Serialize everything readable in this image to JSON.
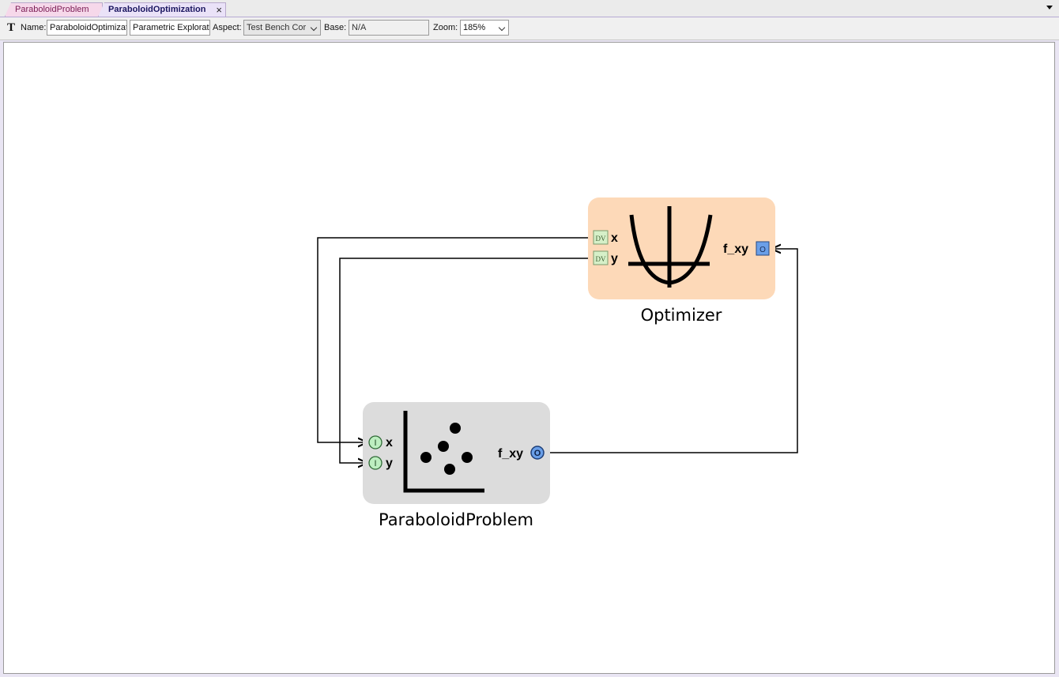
{
  "tabs": [
    {
      "label": "ParaboloidProblem"
    },
    {
      "label": "ParaboloidOptimization",
      "close": "×"
    }
  ],
  "toolbar": {
    "name_label": "Name:",
    "name_value": "ParaboloidOptimizati",
    "kind_value": "Parametric Exploratic",
    "aspect_label": "Aspect:",
    "aspect_value": "Test Bench Cor",
    "base_label": "Base:",
    "base_value": "N/A",
    "zoom_label": "Zoom:",
    "zoom_value": "185%"
  },
  "diagram": {
    "optimizer": {
      "title": "Optimizer",
      "ports_in": [
        {
          "name": "x",
          "badge": "DV"
        },
        {
          "name": "y",
          "badge": "DV"
        }
      ],
      "port_out": {
        "name": "f_xy",
        "badge": "O"
      },
      "fill": "#fdd9b8"
    },
    "problem": {
      "title": "ParaboloidProblem",
      "ports_in": [
        {
          "name": "x",
          "badge": "I"
        },
        {
          "name": "y",
          "badge": "I"
        }
      ],
      "port_out": {
        "name": "f_xy",
        "badge": "O"
      },
      "fill": "#dcdcdc"
    }
  },
  "colors": {
    "dv_port": "#d6f0c8",
    "input_port": "#bdeec0",
    "output_port": "#6a9fe8"
  }
}
